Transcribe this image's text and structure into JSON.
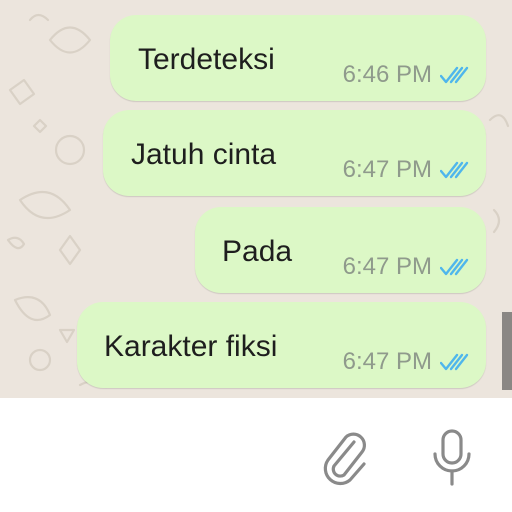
{
  "messages": [
    {
      "text": "Terdeteksi",
      "time": "6:46 PM",
      "status": "read-double-check-icon"
    },
    {
      "text": "Jatuh cinta",
      "time": "6:47 PM",
      "status": "read-double-check-icon"
    },
    {
      "text": "Pada",
      "time": "6:47 PM",
      "status": "read-double-check-icon"
    },
    {
      "text": "Karakter fiksi",
      "time": "6:47 PM",
      "status": "read-double-check-icon"
    }
  ],
  "input_bar": {
    "icons": [
      "paperclip-icon",
      "microphone-icon"
    ]
  },
  "colors": {
    "chat_background": "#ece5dd",
    "outgoing_bubble": "#dcf8c6",
    "read_ticks": "#4fb6ec",
    "timestamp": "#8f9a8c",
    "icon_gray": "#8a8a8a"
  }
}
